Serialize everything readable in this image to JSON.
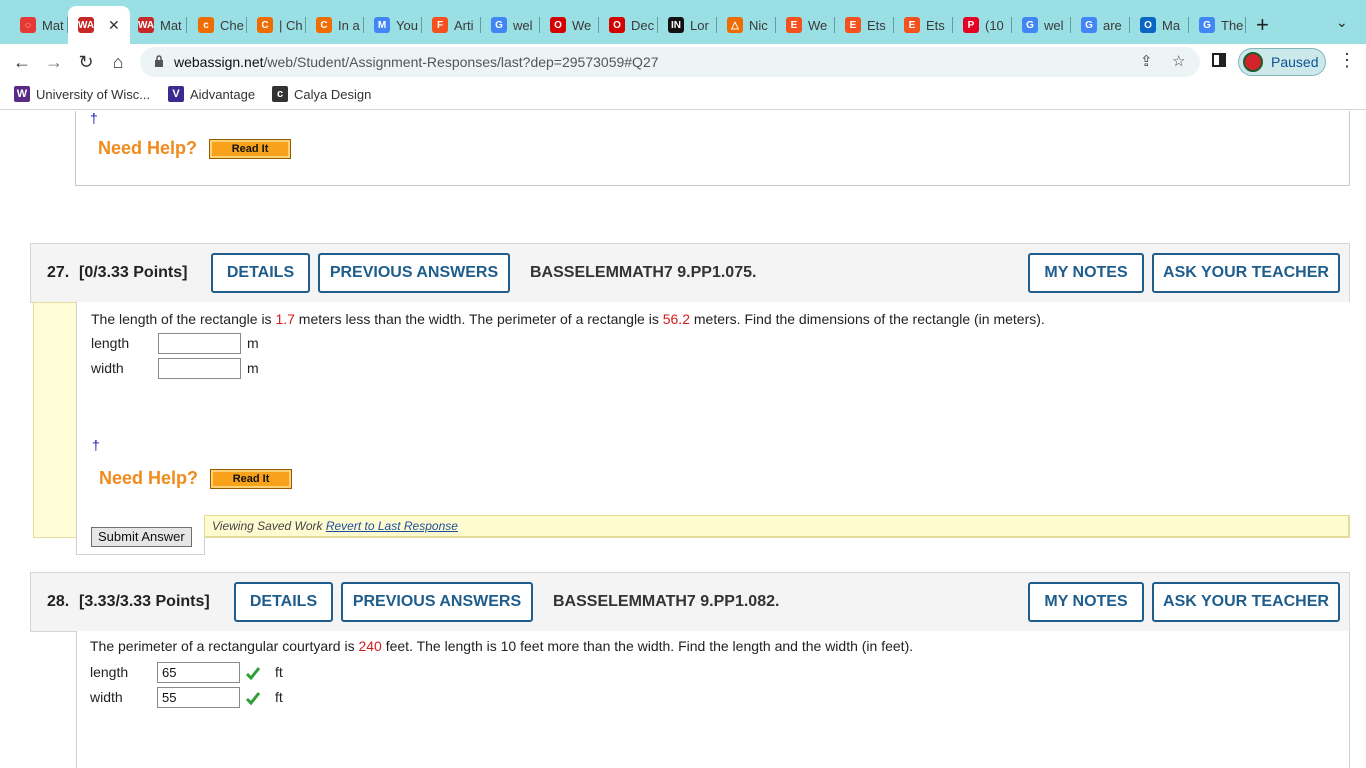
{
  "browser": {
    "tabs": [
      {
        "label": "Mat",
        "fav_color": "#e53935",
        "glyph": "◌"
      },
      {
        "label": "",
        "fav_color": "#c62828",
        "glyph": "WA",
        "active": true
      },
      {
        "label": "Mat",
        "fav_color": "#c62828",
        "glyph": "WA"
      },
      {
        "label": "Che",
        "fav_color": "#ef6c00",
        "glyph": "c"
      },
      {
        "label": "| Ch",
        "fav_color": "#ef6c00",
        "glyph": "C"
      },
      {
        "label": "In a",
        "fav_color": "#ef6c00",
        "glyph": "C"
      },
      {
        "label": "You",
        "fav_color": "#4285f4",
        "glyph": "M"
      },
      {
        "label": "Arti",
        "fav_color": "#f4511e",
        "glyph": "F"
      },
      {
        "label": "wel",
        "fav_color": "#4285f4",
        "glyph": "G"
      },
      {
        "label": "We",
        "fav_color": "#d50000",
        "glyph": "O"
      },
      {
        "label": "Dec",
        "fav_color": "#d50000",
        "glyph": "O"
      },
      {
        "label": "Lor",
        "fav_color": "#111111",
        "glyph": "IN"
      },
      {
        "label": "Nic",
        "fav_color": "#ef6c00",
        "glyph": "△"
      },
      {
        "label": "We",
        "fav_color": "#f4511e",
        "glyph": "E"
      },
      {
        "label": "Ets",
        "fav_color": "#f4511e",
        "glyph": "E"
      },
      {
        "label": "Ets",
        "fav_color": "#f4511e",
        "glyph": "E"
      },
      {
        "label": "(10",
        "fav_color": "#e60023",
        "glyph": "P"
      },
      {
        "label": "wel",
        "fav_color": "#4285f4",
        "glyph": "G"
      },
      {
        "label": "are",
        "fav_color": "#4285f4",
        "glyph": "G"
      },
      {
        "label": "Ma",
        "fav_color": "#0a66c2",
        "glyph": "O"
      },
      {
        "label": "The",
        "fav_color": "#4285f4",
        "glyph": "G"
      }
    ],
    "close_glyph": "✕",
    "new_tab_glyph": "+",
    "tab_menu_glyph": "⌄",
    "nav": {
      "back": "←",
      "forward": "→",
      "reload": "↻",
      "home": "⌂"
    },
    "url_host": "webassign.net",
    "url_path": "/web/Student/Assignment-Responses/last?dep=29573059#Q27",
    "share_glyph": "⇪",
    "star_glyph": "☆",
    "profile_label": "Paused",
    "menu_glyph": "⋮",
    "bookmarks": [
      {
        "label": "University of Wisc...",
        "fav_color": "#5b2a86",
        "glyph": "W"
      },
      {
        "label": "Aidvantage",
        "fav_color": "#3b2a8f",
        "glyph": "V"
      },
      {
        "label": "Calya Design",
        "fav_color": "#333333",
        "glyph": "c"
      }
    ]
  },
  "top_block": {
    "dagger": "†",
    "need_help": "Need Help?",
    "read_it": "Read It"
  },
  "q27": {
    "number": "27.",
    "points": "[0/3.33 Points]",
    "details": "DETAILS",
    "previous": "PREVIOUS ANSWERS",
    "code": "BASSELEMMATH7 9.PP1.075.",
    "my_notes": "MY NOTES",
    "ask_teacher": "ASK YOUR TEACHER",
    "text_1": "The length of the rectangle is ",
    "val_1": "1.7",
    "text_2": " meters less than the width. The perimeter of a rectangle is ",
    "val_2": "56.2",
    "text_3": " meters. Find the dimensions of the rectangle (in meters).",
    "length_label": "length",
    "width_label": "width",
    "length_value": "",
    "width_value": "",
    "unit": "m",
    "dagger": "†",
    "need_help": "Need Help?",
    "read_it": "Read It",
    "submit": "Submit Answer",
    "saved_text": "Viewing Saved Work ",
    "revert": "Revert to Last Response"
  },
  "q28": {
    "number": "28.",
    "points": "[3.33/3.33 Points]",
    "details": "DETAILS",
    "previous": "PREVIOUS ANSWERS",
    "code": "BASSELEMMATH7 9.PP1.082.",
    "my_notes": "MY NOTES",
    "ask_teacher": "ASK YOUR TEACHER",
    "text_1": "The perimeter of a rectangular courtyard is ",
    "val_1": "240",
    "text_2": " feet. The length is 10 feet more than the width. Find the length and the width (in feet).",
    "length_label": "length",
    "width_label": "width",
    "length_value": "65",
    "width_value": "55",
    "unit": "ft",
    "correct_color": "#2e9e3a"
  }
}
